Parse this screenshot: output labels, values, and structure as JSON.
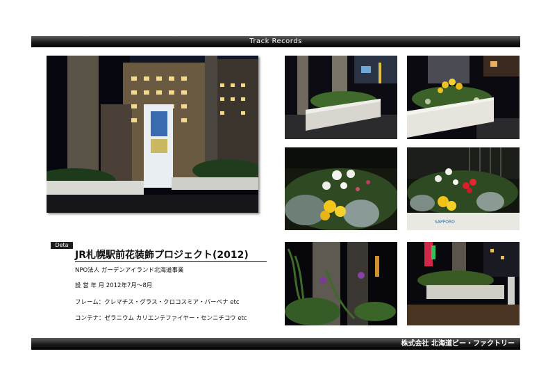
{
  "header": {
    "title": "Track Records"
  },
  "footer": {
    "company": "株式会社 北海道ビー・ファクトリー"
  },
  "detail": {
    "badge": "Deta",
    "title": "JR札幌駅前花装飾プロジェクト(2012)",
    "organization": "NPO法人 ガーデンアイランド北海道事業",
    "period": "設 営 年 月 2012年7月～8月",
    "frame": "フレーム：クレマチス・グラス・クロコスミア・バーベナ etc",
    "container": "コンテナ：ゼラニウム カリエンテファイヤー・センニチコウ etc"
  },
  "photos": {
    "p4_sign": "SAPPORO"
  }
}
